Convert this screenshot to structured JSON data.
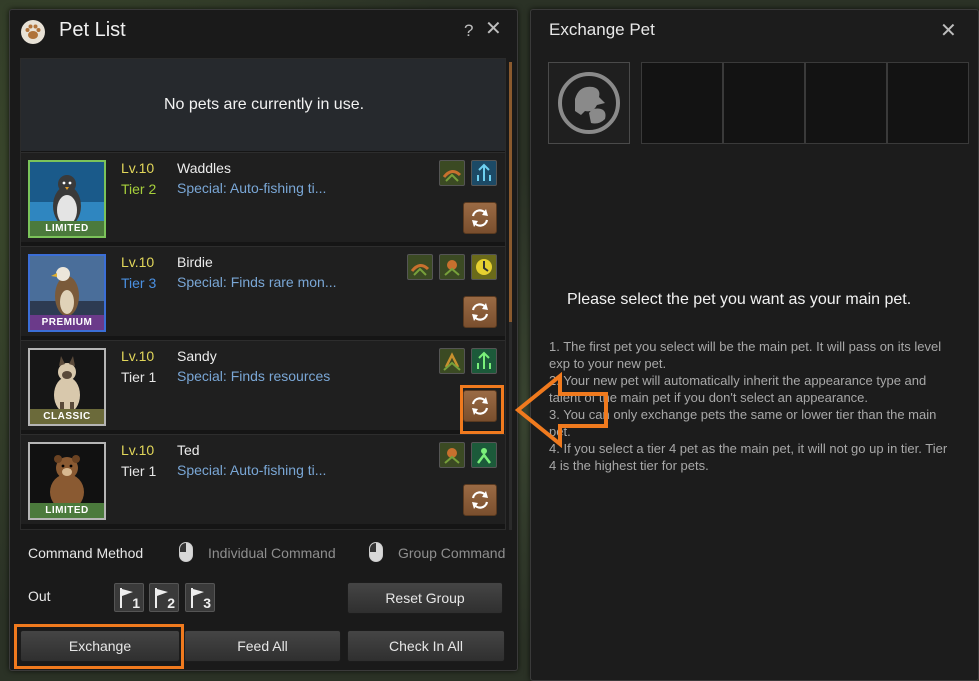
{
  "left_panel": {
    "title": "Pet List",
    "help": "?",
    "close": "✕",
    "no_pets_message": "No pets are currently in use.",
    "pets": [
      {
        "level": "Lv.10",
        "tier": "Tier 2",
        "tier_color": "#a6cf3b",
        "name": "Waddles",
        "special": "Special: Auto-fishing ti...",
        "grade": "LIMITED",
        "grade_color": "#4b7a3c",
        "border_color": "#7bc35a"
      },
      {
        "level": "Lv.10",
        "tier": "Tier 3",
        "tier_color": "#4a90e2",
        "name": "Birdie",
        "special": "Special: Finds rare mon...",
        "grade": "PREMIUM",
        "grade_color": "#6b3a8a",
        "border_color": "#3b6ed6"
      },
      {
        "level": "Lv.10",
        "tier": "Tier 1",
        "tier_color": "#e6e6e6",
        "name": "Sandy",
        "special": "Special: Finds resources",
        "grade": "CLASSIC",
        "grade_color": "#6b6a3a",
        "border_color": "#b5b5b5"
      },
      {
        "level": "Lv.10",
        "tier": "Tier 1",
        "tier_color": "#e6e6e6",
        "name": "Ted",
        "special": "Special: Auto-fishing ti...",
        "grade": "LIMITED",
        "grade_color": "#4b7a3c",
        "border_color": "#b5b5b5"
      }
    ],
    "command_method_label": "Command Method",
    "individual_command": "Individual Command",
    "group_command": "Group Command",
    "out_label": "Out",
    "flags": [
      "1",
      "2",
      "3"
    ],
    "reset_group": "Reset Group",
    "exchange": "Exchange",
    "feed_all": "Feed All",
    "check_in_all": "Check In All"
  },
  "right_panel": {
    "title": "Exchange Pet",
    "close": "✕",
    "prompt": "Please select the pet you want as your main pet.",
    "notes": [
      "1. The first pet you select will be the main pet. It will pass on its level exp to your new pet.",
      "2. Your new pet will automatically inherit the appearance type and talent of the main pet if you don't select an appearance.",
      "3. You can only exchange pets the same or lower tier than the main pet.",
      "4. If you select a tier 4 pet as the main pet, it will not go up in tier. Tier 4 is the highest tier for pets."
    ]
  },
  "colors": {
    "highlight": "#f07a1e",
    "level": "#e1d65a",
    "special": "#7aa7d6"
  }
}
